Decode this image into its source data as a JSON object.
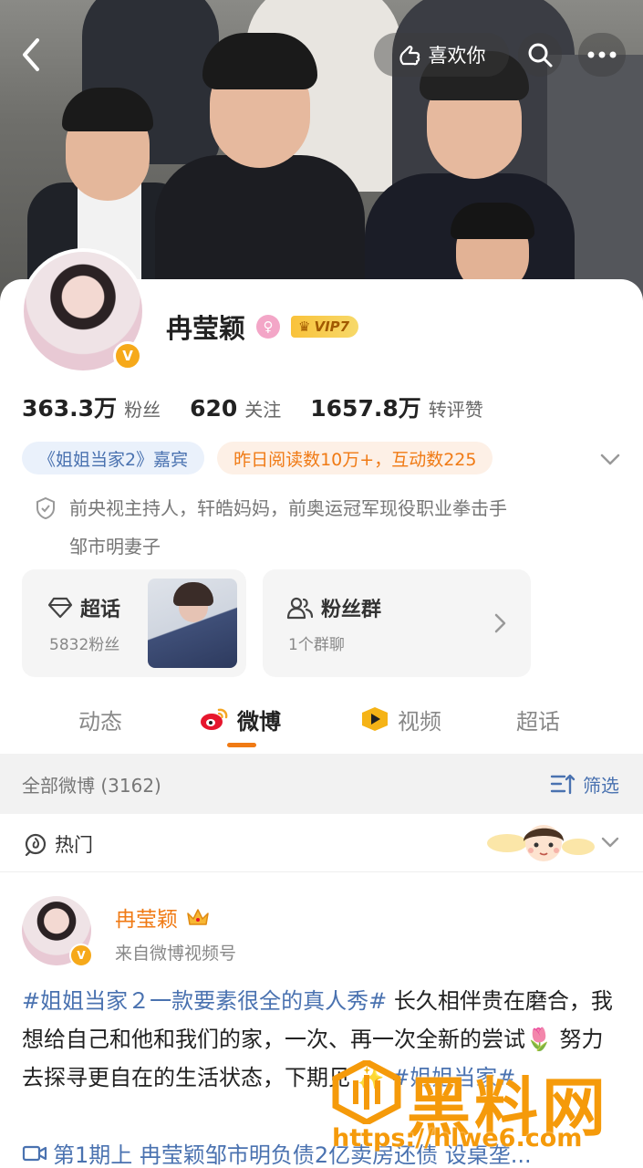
{
  "nav": {
    "like_label": "喜欢你"
  },
  "profile": {
    "name": "冉莹颖",
    "vip_label": "VIP7",
    "stats": [
      {
        "num": "363.3万",
        "label": "粉丝"
      },
      {
        "num": "620",
        "label": "关注"
      },
      {
        "num": "1657.8万",
        "label": "转评赞"
      }
    ],
    "tags": [
      {
        "text": "《姐姐当家2》嘉宾"
      },
      {
        "text": "昨日阅读数10万+，互动数225"
      }
    ],
    "bio_line1": "前央视主持人，轩皓妈妈，前奥运冠军现役职业拳击手",
    "bio_line2": "邹市明妻子"
  },
  "tiles": {
    "super": {
      "title": "超话",
      "sub": "5832粉丝"
    },
    "group": {
      "title": "粉丝群",
      "sub": "1个群聊"
    }
  },
  "tabs": [
    {
      "label": "动态"
    },
    {
      "label": "微博"
    },
    {
      "label": "视频"
    },
    {
      "label": "超话"
    }
  ],
  "filter": {
    "title": "全部微博 (3162)",
    "button": "筛选"
  },
  "hot": {
    "label": "热门"
  },
  "post": {
    "author": "冉莹颖",
    "source": "来自微博视频号",
    "topic1": "#姐姐当家２一款要素很全的真人秀#",
    "text1": " 长久相伴贵在磨合，我想给自己和他和我们的家，一次、再一次全新的尝试",
    "text2": " 努力去探寻更自在的生活状态，下期见",
    "topic2": "#姐姐当家#",
    "link": "第1期上 冉莹颖邹市明负债2亿卖房还债 设桌垄..."
  },
  "watermark": {
    "text": "黑料网",
    "url": "https://hlwe6.com"
  },
  "colors": {
    "accent": "#f07a14",
    "link": "#4a72b0",
    "vip": "#f9c23a"
  }
}
